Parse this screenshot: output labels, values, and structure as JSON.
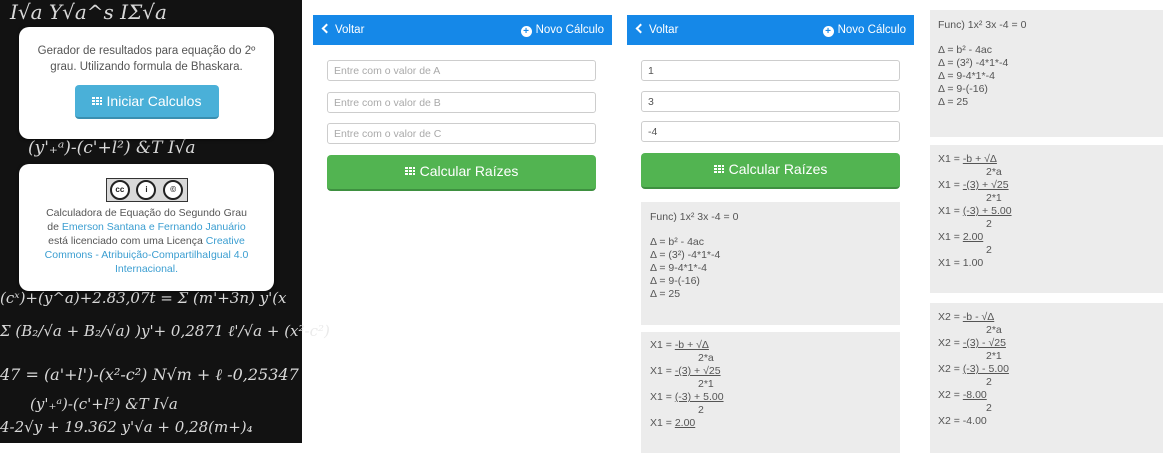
{
  "intro": {
    "description": "Gerador de resultados para equação do 2º grau. Utilizando formula de Bhaskara.",
    "start_button": "Iniciar Calculos"
  },
  "license": {
    "cc_badge": [
      "cc",
      "i",
      "©"
    ],
    "cc_badge_caption": "BY NC",
    "line1": "Calculadora de Equação do Segundo Grau",
    "line2_prefix": "de ",
    "authors": "Emerson Santana e Fernando Januário",
    "line3": "está licenciado com uma Licença ",
    "license_link": "Creative Commons - Atribuição-CompartilhaIgual 4.0 Internacional.",
    "license_link_lines": [
      "Creative",
      "Commons - Atribuição-CompartilhaIgual 4.0",
      "Internacional."
    ]
  },
  "chalk_formulas": [
    "I√a   Y√a^s   IΣ√a",
    "(y'₊ᵃ)-(c'+l²) &T   I√a",
    "(cˣ)+(y^a)+2.83,07t = Σ (m'+3n) y'(x",
    "Σ (B₂/√a + B₂/√a) )y'+ 0,2871 ℓ'/√a + (x²-c²)",
    "47 = (a'+l')-(x²-c²)  N√m + ℓ  -0,25347",
    "(y'₊ᵃ)-(c'+l²) &T  I√a",
    "4-2√y + 19.362 y'√a + 0,28(m+)₄"
  ],
  "topbar": {
    "back_label": "Voltar",
    "new_calc_label": "Novo Cálculo"
  },
  "form_empty": {
    "placeholder_a": "Entre com o valor de A",
    "placeholder_b": "Entre com o valor de B",
    "placeholder_c": "Entre com o valor de C",
    "calc_button": "Calcular Raízes"
  },
  "form_filled": {
    "value_a": "1",
    "value_b": "3",
    "value_c": "-4",
    "calc_button": "Calcular Raízes"
  },
  "result": {
    "func": "Func) 1x² 3x -4 = 0",
    "delta_lines": [
      "Δ = b² - 4ac",
      "Δ = (3²) -4*1*-4",
      "Δ = 9-4*1*-4",
      "Δ = 9-(-16)",
      "Δ = 25"
    ],
    "x1_lines": [
      {
        "lhs": "X1 = ",
        "num": "-b + √Δ",
        "den": "2*a"
      },
      {
        "lhs": "X1 = ",
        "num": "-(3) + √25",
        "den": "2*1"
      },
      {
        "lhs": "X1 = ",
        "num": "(-3) + 5.00",
        "den": "2"
      },
      {
        "lhs": "X1 = ",
        "num": "2.00",
        "den": "2"
      }
    ],
    "x1_final": "X1 = 1.00",
    "x2_lines": [
      {
        "lhs": "X2 = ",
        "num": "-b - √Δ",
        "den": "2*a"
      },
      {
        "lhs": "X2 = ",
        "num": "-(3) - √25",
        "den": "2*1"
      },
      {
        "lhs": "X2 = ",
        "num": "(-3) - 5.00",
        "den": "2"
      },
      {
        "lhs": "X2 = ",
        "num": "-8.00",
        "den": "2"
      }
    ],
    "x2_final": "X2 = -4.00"
  }
}
